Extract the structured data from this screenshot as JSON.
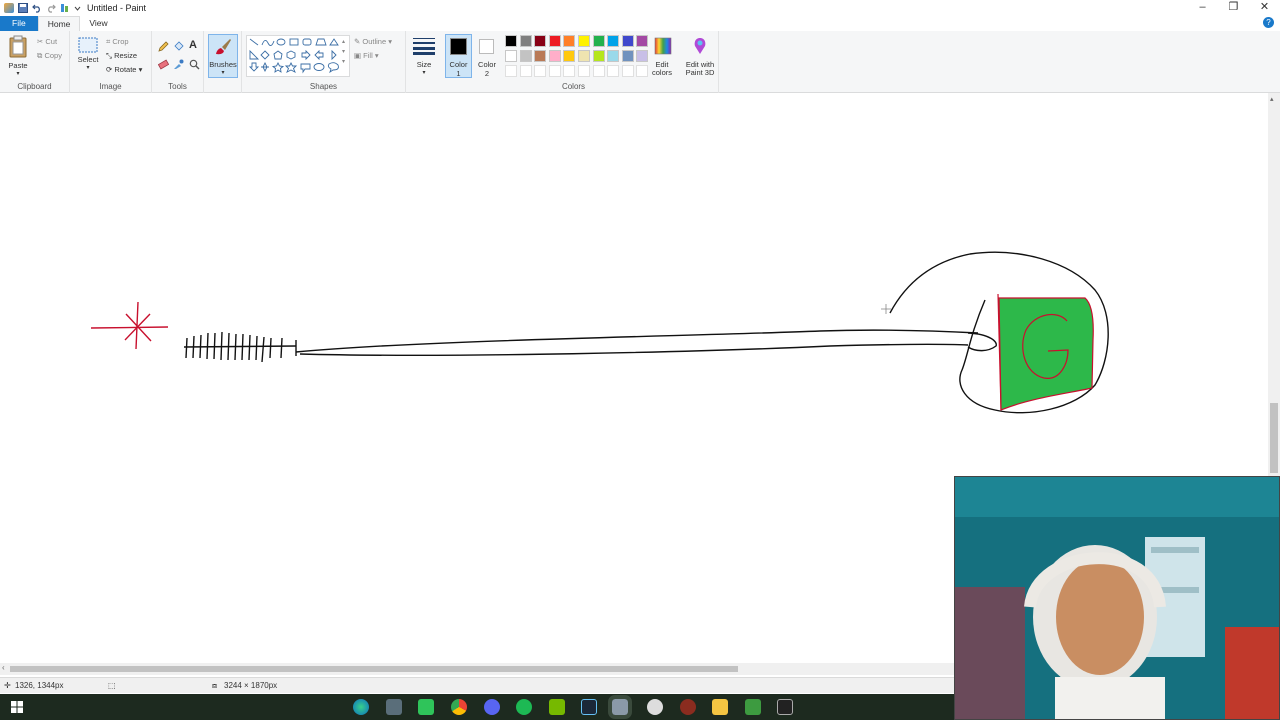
{
  "window": {
    "title": "Untitled - Paint"
  },
  "menu": {
    "tabs": [
      "File",
      "Home",
      "View"
    ]
  },
  "clipboard": {
    "paste": "Paste",
    "cut": "Cut",
    "copy": "Copy",
    "label": "Clipboard"
  },
  "image": {
    "select": "Select",
    "crop": "Crop",
    "resize": "Resize",
    "rotate": "Rotate",
    "label": "Image"
  },
  "tools": {
    "label": "Tools",
    "text_tool": "A"
  },
  "brushes": {
    "label": "Brushes"
  },
  "shapes": {
    "outline": "Outline",
    "fill": "Fill",
    "label": "Shapes"
  },
  "size": {
    "label": "Size"
  },
  "color1": {
    "line1": "Color",
    "line2": "1"
  },
  "color2": {
    "line1": "Color",
    "line2": "2"
  },
  "colors": {
    "label": "Colors",
    "edit_line1": "Edit",
    "edit_line2": "colors",
    "palette_row1": [
      "#000000",
      "#7f7f7f",
      "#880015",
      "#ed1c24",
      "#ff7f27",
      "#fff200",
      "#22b14c",
      "#00a2e8",
      "#3f48cc",
      "#a349a4"
    ],
    "palette_row2": [
      "#ffffff",
      "#c3c3c3",
      "#b97a57",
      "#ffaec9",
      "#ffc90e",
      "#efe4b0",
      "#b5e61d",
      "#99d9ea",
      "#7092be",
      "#c8bfe7"
    ],
    "selected_color1": "#000000",
    "selected_color2": "#ffffff"
  },
  "paint3d": {
    "line1": "Edit with",
    "line2": "Paint 3D"
  },
  "drawing": {
    "letter": "G",
    "box_fill": "#2db84a",
    "stroke_red": "#c8102e"
  },
  "status": {
    "cursor_pos": "1326, 1344px",
    "canvas_size": "3244 × 1870px"
  },
  "taskbar": {
    "apps": [
      "start",
      "edge-icon",
      "app-icon",
      "whatsapp-icon",
      "chrome-icon",
      "discord-icon",
      "spotify-icon",
      "nvidia-icon",
      "steam-icon",
      "paint-icon",
      "obs-icon",
      "record-icon",
      "explorer-icon",
      "terminal-icon",
      "monitor-icon"
    ]
  }
}
